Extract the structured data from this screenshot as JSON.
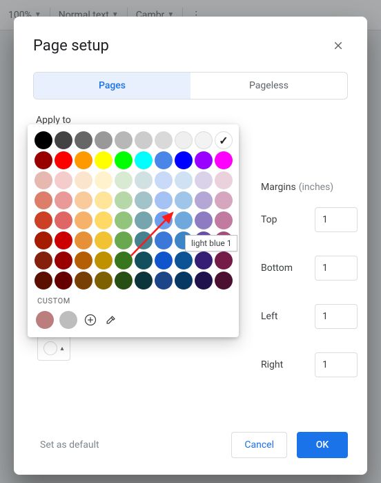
{
  "toolbar_bg": {
    "zoom": "100%",
    "style": "Normal text",
    "font": "Cambr"
  },
  "dialog": {
    "title": "Page setup",
    "tabs": {
      "pages": "Pages",
      "pageless": "Pageless",
      "active": "pages"
    },
    "apply_to": "Apply to",
    "margins": {
      "label": "Margins",
      "unit": "(inches)",
      "top": {
        "label": "Top",
        "value": "1"
      },
      "bottom": {
        "label": "Bottom",
        "value": "1"
      },
      "left": {
        "label": "Left",
        "value": "1"
      },
      "right": {
        "label": "Right",
        "value": "1"
      }
    },
    "set_default": "Set as default",
    "cancel": "Cancel",
    "ok": "OK"
  },
  "palette": {
    "custom_label": "CUSTOM",
    "tooltip": "light blue 1",
    "selected_index": 9,
    "custom_swatches": [
      "#bb7e7e",
      "#bdbdbd"
    ],
    "rows": [
      [
        "#000000",
        "#434343",
        "#666666",
        "#999999",
        "#b7b7b7",
        "#cccccc",
        "#d9d9d9",
        "#efefef",
        "#f3f3f3",
        "#ffffff"
      ],
      [
        "#980000",
        "#ff0000",
        "#ff9900",
        "#ffff00",
        "#00ff00",
        "#00ffff",
        "#4a86e8",
        "#0000ff",
        "#9900ff",
        "#ff00ff"
      ],
      [
        "#e6b8af",
        "#f4cccc",
        "#fce5cd",
        "#fff2cc",
        "#d9ead3",
        "#d0e0e3",
        "#c9daf8",
        "#cfe2f3",
        "#d9d2e9",
        "#ead1dc"
      ],
      [
        "#dd7e6b",
        "#ea9999",
        "#f9cb9c",
        "#ffe599",
        "#b6d7a8",
        "#a2c4c9",
        "#a4c2f4",
        "#9fc5e8",
        "#b4a7d6",
        "#d5a6bd"
      ],
      [
        "#cc4125",
        "#e06666",
        "#f6b26b",
        "#ffd966",
        "#93c47d",
        "#76a5af",
        "#6d9eeb",
        "#6fa8dc",
        "#8e7cc3",
        "#c27ba0"
      ],
      [
        "#a61c00",
        "#cc0000",
        "#e69138",
        "#f1c232",
        "#6aa84f",
        "#45818e",
        "#3c78d8",
        "#3d85c6",
        "#674ea7",
        "#a64d79"
      ],
      [
        "#85200c",
        "#990000",
        "#b45f06",
        "#bf9000",
        "#38761d",
        "#134f5c",
        "#1155cc",
        "#0b5394",
        "#351c75",
        "#741b47"
      ],
      [
        "#5b0f00",
        "#660000",
        "#783f04",
        "#7f6000",
        "#274e13",
        "#0c343d",
        "#1c4587",
        "#073763",
        "#20124d",
        "#4c1130"
      ]
    ]
  }
}
